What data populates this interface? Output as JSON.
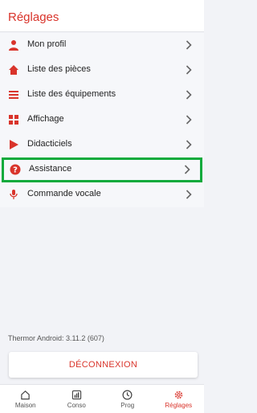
{
  "header": {
    "title": "Réglages"
  },
  "menu": {
    "items": [
      {
        "label": "Mon profil",
        "icon": "user-icon"
      },
      {
        "label": "Liste des pièces",
        "icon": "home-icon"
      },
      {
        "label": "Liste des équipements",
        "icon": "list-icon"
      },
      {
        "label": "Affichage",
        "icon": "grid-icon"
      },
      {
        "label": "Didacticiels",
        "icon": "play-icon"
      },
      {
        "label": "Assistance",
        "icon": "help-icon"
      },
      {
        "label": "Commande vocale",
        "icon": "microphone-icon"
      }
    ]
  },
  "version": "Thermor Android: 3.11.2 (607)",
  "logout_label": "DÉCONNEXION",
  "tabbar": {
    "tabs": [
      {
        "label": "Maison",
        "icon": "house-icon"
      },
      {
        "label": "Conso",
        "icon": "consumption-icon"
      },
      {
        "label": "Prog",
        "icon": "clock-icon"
      },
      {
        "label": "Réglages",
        "icon": "settings-icon"
      }
    ],
    "active": "Réglages"
  },
  "colors": {
    "accent": "#d9342b",
    "highlight": "#0faa3c",
    "background": "#f2f3f7"
  }
}
